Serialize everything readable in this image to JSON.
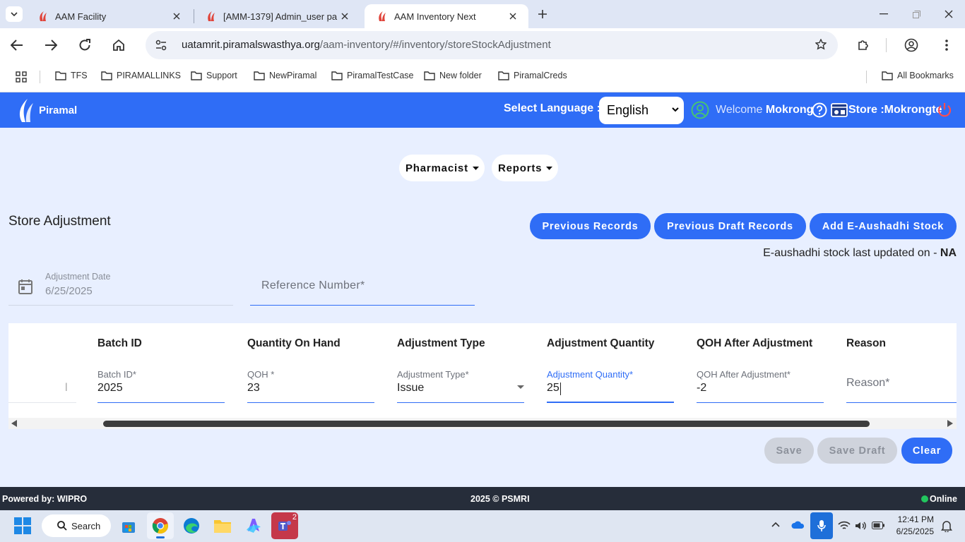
{
  "browser": {
    "tabs": [
      {
        "title": "AAM Facility",
        "active": false
      },
      {
        "title": "[AMM-1379] Admin_user pa",
        "active": false
      },
      {
        "title": "AAM Inventory Next",
        "active": true
      }
    ],
    "url_domain": "uatamrit.piramalswasthya.org",
    "url_path": "/aam-inventory/#/inventory/storeStockAdjustment",
    "bookmarks": [
      "TFS",
      "PIRAMALLINKS",
      "Support",
      "NewPiramal",
      "PiramalTestCase",
      "New folder",
      "PiramalCreds"
    ],
    "all_bookmarks": "All Bookmarks"
  },
  "header": {
    "logo_text": "Piramal",
    "language_label": "Select Language :",
    "language_value": "English",
    "welcome_prefix": "Welcome",
    "user_name": "Mokrong",
    "store_text": "Store :Mokrongte",
    "brand_color": "#2f6df6"
  },
  "menu": {
    "pharmacist": "Pharmacist",
    "reports": "Reports"
  },
  "page": {
    "title": "Store Adjustment",
    "buttons": {
      "previous_records": "Previous Records",
      "previous_draft_records": "Previous Draft Records",
      "add_eaushadhi": "Add E-Aushadhi Stock"
    },
    "eaushadhi_note_prefix": "E-aushadhi stock last updated on - ",
    "eaushadhi_note_value": "NA"
  },
  "form": {
    "adjustment_date_label": "Adjustment Date",
    "adjustment_date_value": "6/25/2025",
    "reference_placeholder": "Reference Number*"
  },
  "table": {
    "headers": [
      "Batch ID",
      "Quantity On Hand",
      "Adjustment Type",
      "Adjustment Quantity",
      "QOH After Adjustment",
      "Reason"
    ],
    "cut_cell_text": "l",
    "row": {
      "batch_id_label": "Batch ID*",
      "batch_id": "2025",
      "qoh_label": "QOH *",
      "qoh": "23",
      "adj_type_label": "Adjustment Type*",
      "adj_type": "Issue",
      "adj_qty_label": "Adjustment Quantity*",
      "adj_qty": "25",
      "qoh_after_label": "QOH After Adjustment*",
      "qoh_after": "-2",
      "reason_placeholder": "Reason*"
    }
  },
  "actions": {
    "save": "Save",
    "save_draft": "Save Draft",
    "clear": "Clear"
  },
  "footer": {
    "powered_by": "Powered by: WIPRO",
    "copyright": "2025 © PSMRI",
    "status": "Online"
  },
  "taskbar": {
    "search": "Search",
    "teams_badge": "2",
    "time": "12:41 PM",
    "date": "6/25/2025"
  }
}
